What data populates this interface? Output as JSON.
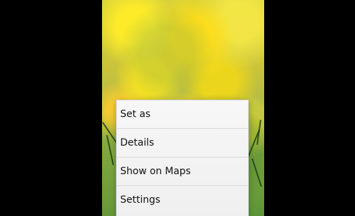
{
  "context_menu": {
    "items": [
      {
        "label": "Set as"
      },
      {
        "label": "Details"
      },
      {
        "label": "Show on Maps"
      },
      {
        "label": "Settings"
      }
    ]
  }
}
